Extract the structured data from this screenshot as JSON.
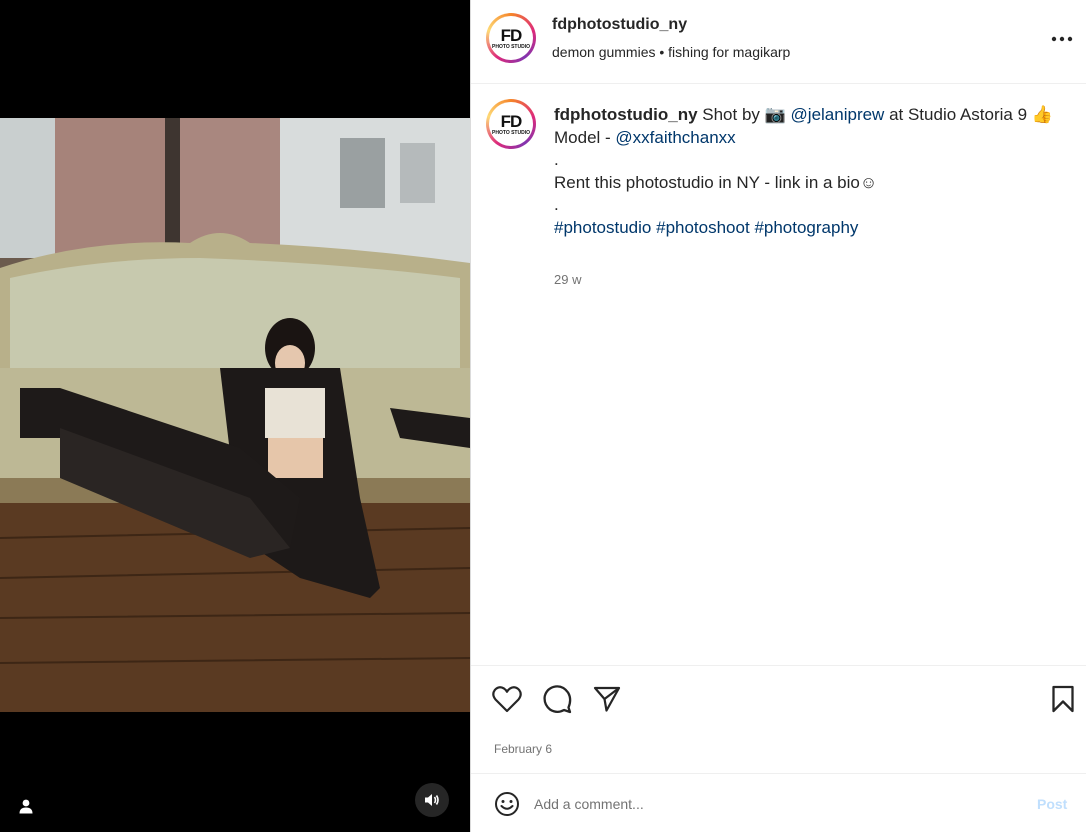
{
  "post": {
    "username": "fdphotostudio_ny",
    "subtitle": "demon gummies • fishing for magikarp",
    "avatar_text": "FD",
    "avatar_subtext": "PHOTO STUDIO",
    "caption": {
      "text_before_link1": " Shot by 📷  ",
      "link1": "@jelaniprew",
      "text_after_link1": " at Studio Astoria 9 👍",
      "model_prefix": "Model - ",
      "link2": "@xxfaithchanxx",
      "dot1": ".",
      "rent_text": "Rent this photostudio in NY - link in a bio☺",
      "dot2": ".",
      "hashtag1": "#photostudio",
      "hashtag2": "#photoshoot",
      "hashtag3": "#photography"
    },
    "time_ago": "29 w",
    "date": "February 6"
  },
  "comment_box": {
    "placeholder": "Add a comment...",
    "post_label": "Post"
  },
  "icons": {
    "more": "more-options-icon",
    "like": "heart-icon",
    "comment": "comment-icon",
    "share": "paper-plane-icon",
    "save": "bookmark-icon",
    "emoji": "smiley-icon",
    "user_tag": "person-icon",
    "audio": "speaker-icon"
  },
  "colors": {
    "link": "#00376b",
    "post_disabled": "#c0dffd",
    "secondary_text": "#737373"
  }
}
